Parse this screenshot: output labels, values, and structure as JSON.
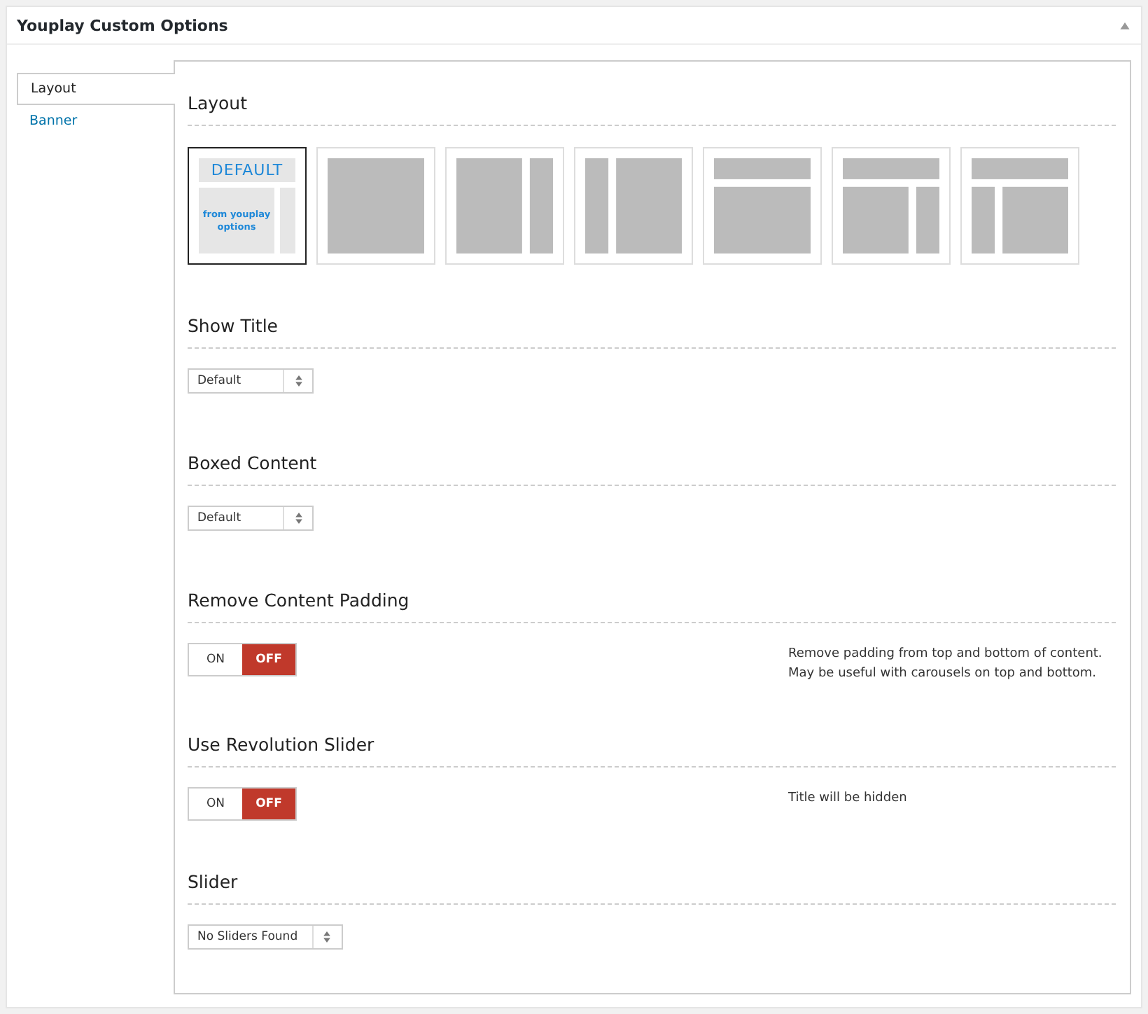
{
  "panel": {
    "title": "Youplay Custom Options"
  },
  "tabs": [
    {
      "label": "Layout",
      "selected": true
    },
    {
      "label": "Banner",
      "selected": false
    }
  ],
  "sections": [
    {
      "title": "Layout",
      "kind": "layouts",
      "options": [
        {
          "kind": "default",
          "heading": "DEFAULT",
          "caption": "from youplay options",
          "selected": true
        },
        {
          "kind": "full",
          "selected": false
        },
        {
          "kind": "right-sidebar",
          "selected": false
        },
        {
          "kind": "left-sidebar",
          "selected": false
        },
        {
          "kind": "banner-full",
          "selected": false
        },
        {
          "kind": "banner-right-sidebar",
          "selected": false
        },
        {
          "kind": "banner-left-sidebar",
          "selected": false
        }
      ]
    },
    {
      "title": "Show Title",
      "kind": "select",
      "value": "Default"
    },
    {
      "title": "Boxed Content",
      "kind": "select",
      "value": "Default"
    },
    {
      "title": "Remove Content Padding",
      "kind": "toggle",
      "on_label": "ON",
      "off_label": "OFF",
      "on": false,
      "description": [
        "Remove padding from top and bottom of content.",
        "May be useful with carousels on top and bottom."
      ]
    },
    {
      "title": "Use Revolution Slider",
      "kind": "toggle",
      "on_label": "ON",
      "off_label": "OFF",
      "on": false,
      "description": [
        "Title will be hidden"
      ]
    },
    {
      "title": "Slider",
      "kind": "select",
      "value": "No Sliders Found"
    }
  ]
}
